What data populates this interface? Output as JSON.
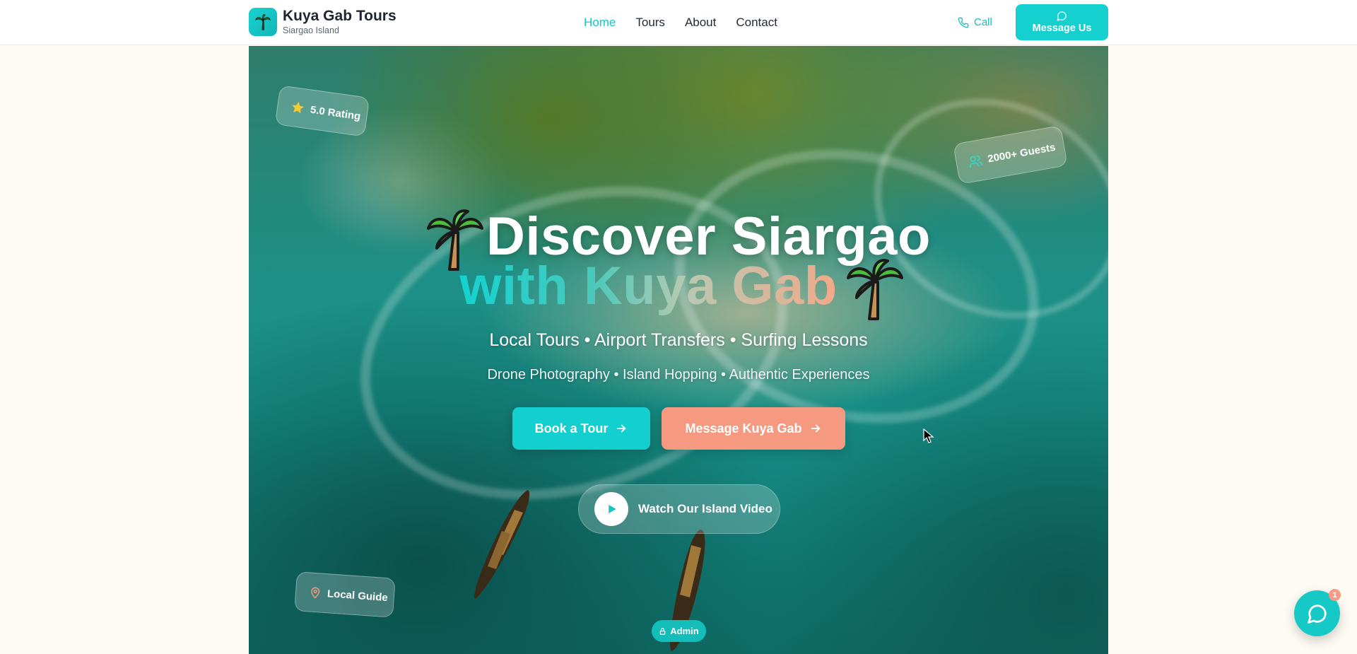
{
  "brand": {
    "title": "Kuya Gab Tours",
    "subtitle": "Siargao Island",
    "logo_icon": "palm-tree-icon"
  },
  "nav": {
    "items": [
      {
        "label": "Home",
        "active": true
      },
      {
        "label": "Tours",
        "active": false
      },
      {
        "label": "About",
        "active": false
      },
      {
        "label": "Contact",
        "active": false
      }
    ],
    "call_label": "Call",
    "message_label": "Message Us"
  },
  "hero": {
    "badges": {
      "rating": "5.0 Rating",
      "guests": "2000+ Guests",
      "local": "Local Guide"
    },
    "title_line1": "Discover Siargao",
    "title_line2": "with Kuya Gab",
    "tagline1": "Local Tours • Airport Transfers • Surfing Lessons",
    "tagline2": "Drone Photography • Island Hopping • Authentic Experiences",
    "book_label": "Book a Tour",
    "message_label": "Message Kuya Gab",
    "video_label": "Watch Our Island Video",
    "admin_label": "Admin"
  },
  "chat": {
    "badge": "1"
  },
  "colors": {
    "accent": "#16cfcf",
    "coral": "#f59a80",
    "text": "#1d2530"
  }
}
